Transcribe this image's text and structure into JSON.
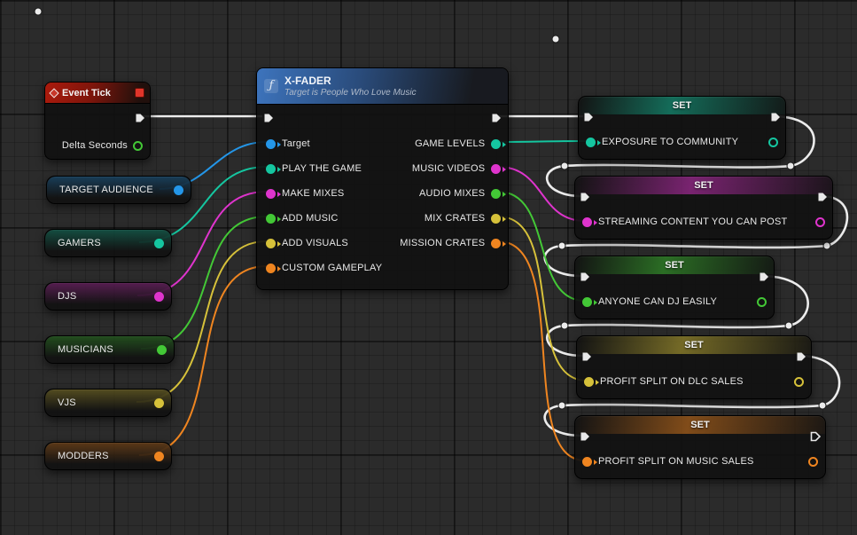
{
  "colors": {
    "exec": "#ececec",
    "blue": "#2496e8",
    "teal": "#15c6a0",
    "magenta": "#df34cd",
    "green": "#43c836",
    "yellow": "#d6c13a",
    "orange": "#ef8520",
    "event_header_red": "#a8170b",
    "function_header_blue": "#3d74bd"
  },
  "event_tick": {
    "title": "Event Tick",
    "delta_label": "Delta Seconds",
    "delta_color": "#43c836"
  },
  "variables": [
    {
      "label": "TARGET AUDIENCE",
      "color": "#2496e8"
    },
    {
      "label": "GAMERS",
      "color": "#15c6a0"
    },
    {
      "label": "DJS",
      "color": "#df34cd"
    },
    {
      "label": "MUSICIANS",
      "color": "#43c836"
    },
    {
      "label": "VJS",
      "color": "#d6c13a"
    },
    {
      "label": "MODDERS",
      "color": "#ef8520"
    }
  ],
  "xfader": {
    "title": "X-FADER",
    "subtitle": "Target is People Who Love Music",
    "inputs": [
      {
        "label": "Target",
        "color": "#2496e8"
      },
      {
        "label": "PLAY THE GAME",
        "color": "#15c6a0"
      },
      {
        "label": "MAKE MIXES",
        "color": "#df34cd"
      },
      {
        "label": "ADD MUSIC",
        "color": "#43c836"
      },
      {
        "label": "ADD VISUALS",
        "color": "#d6c13a"
      },
      {
        "label": "CUSTOM GAMEPLAY",
        "color": "#ef8520"
      }
    ],
    "outputs": [
      {
        "label": "GAME LEVELS",
        "color": "#15c6a0"
      },
      {
        "label": "MUSIC VIDEOS",
        "color": "#df34cd"
      },
      {
        "label": "AUDIO MIXES",
        "color": "#43c836"
      },
      {
        "label": "MIX CRATES",
        "color": "#d6c13a"
      },
      {
        "label": "MISSION CRATES",
        "color": "#ef8520"
      }
    ]
  },
  "setters": [
    {
      "title": "SET",
      "label": "EXPOSURE TO COMMUNITY",
      "color": "#15c6a0"
    },
    {
      "title": "SET",
      "label": "STREAMING CONTENT YOU CAN POST",
      "color": "#df34cd"
    },
    {
      "title": "SET",
      "label": "ANYONE CAN DJ EASILY",
      "color": "#43c836"
    },
    {
      "title": "SET",
      "label": "PROFIT SPLIT ON DLC SALES",
      "color": "#d6c13a"
    },
    {
      "title": "SET",
      "label": "PROFIT SPLIT ON MUSIC SALES",
      "color": "#ef8520"
    }
  ]
}
